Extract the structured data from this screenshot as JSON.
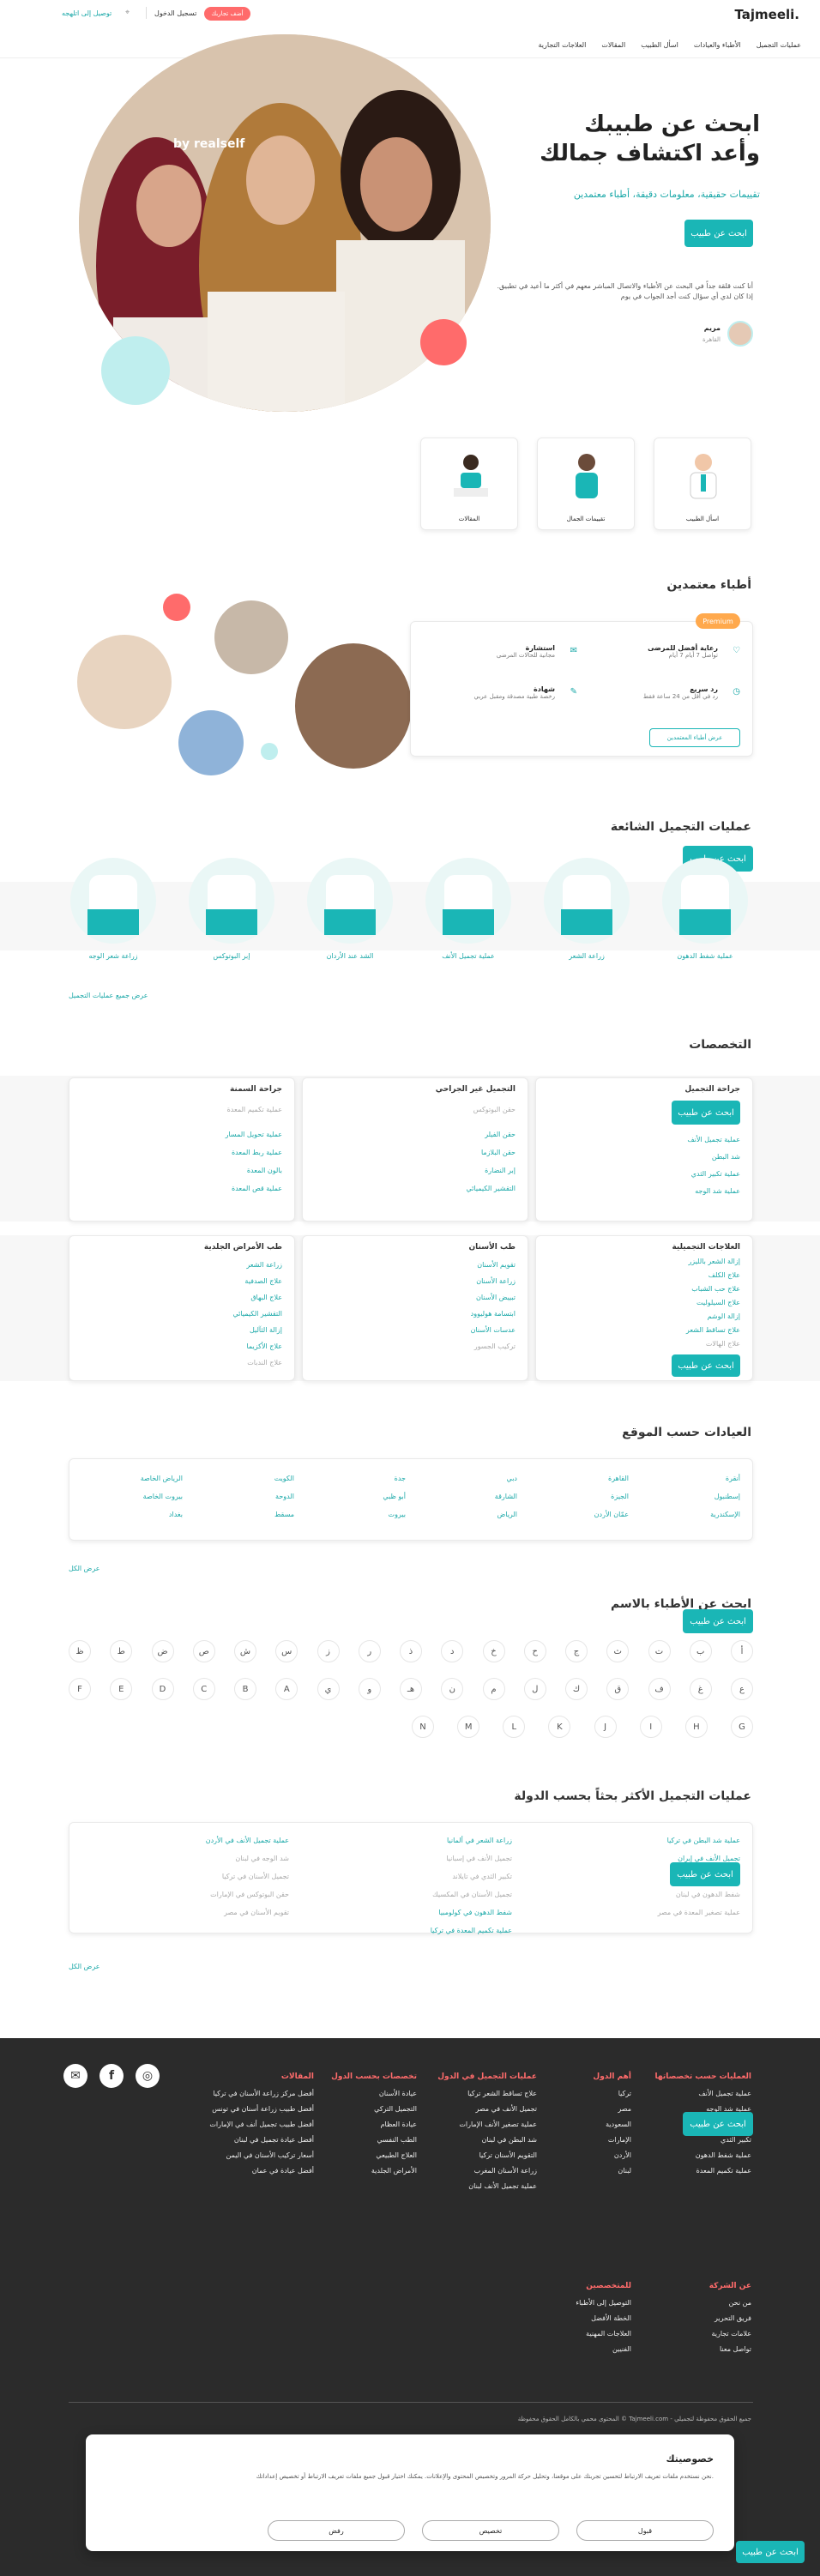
{
  "header": {
    "logo": "Tajmeeli.",
    "nav": [
      "عمليات التجميل",
      "الأطباء والعيادات",
      "اسأل الطبيب",
      "المقالات",
      "العلاجات التجارية"
    ],
    "user_location": "توصيل إلى اتلهجه",
    "login_label": "تسجيل الدخول",
    "cta_label": "أضف تجاربك"
  },
  "hero": {
    "title_line1": "ابحث عن طبيبك",
    "title_line2": "وأعد اكتشاف جمالك",
    "subtitle": "تقييمات حقيقية، معلومات دقيقة، أطباء معتمدين",
    "cta": "ابحث عن طبيب",
    "quote": "أنا كنت قلقة جداً في البحث عن الأطباء والاتصال المباشر معهم في أكثر ما أعيد في تطبيق. إذا كان لدي أي سؤال كنت أجد الجواب في يوم",
    "author_name": "مريم",
    "author_sub": "القاهرة",
    "brand": "by realself"
  },
  "quick_cards": [
    {
      "label": "اسأل الطبيب"
    },
    {
      "label": "تقييمات الجمال"
    },
    {
      "label": "المقالات"
    }
  ],
  "doctors": {
    "title": "أطباء معتمدين",
    "badge": "Premium",
    "features": [
      {
        "title": "رعاية أفضل للمرضى",
        "sub": "تواصل 7 أيام 7 أيام"
      },
      {
        "title": "استشارة",
        "sub": "مجانية للحالات المرضى"
      },
      {
        "title": "رد سريع",
        "sub": "رد في أقل من 24 ساعة فقط"
      },
      {
        "title": "شهادة",
        "sub": "رخصة طبية مصدقة ومقبل عربي"
      }
    ],
    "cta": "عرض أطباء المعتمدين"
  },
  "popular": {
    "title": "عمليات التجميل الشائعة",
    "cta": "ابحث عن طبيب",
    "items": [
      "عملية شفط الدهون",
      "زراعة الشعر",
      "عملية تجميل الأنف",
      "الشد عند الأردان",
      "إبر البوتوكس",
      "زراعة شعر الوجه"
    ],
    "see_all": "عرض جميع عمليات التجميل"
  },
  "specialties": {
    "title": "التخصصات",
    "cta": "ابحث عن طبيب",
    "col1_head": "جراحة التجميل",
    "col1": [
      "عملية تجميل الأنف",
      "شد البطن",
      "عملية تكبير الثدي",
      "عملية شد الوجه",
      "عملية شد الرقبة"
    ],
    "col2_head": "التجميل غير الجراحي",
    "col2": [
      "حقن البوتوكس",
      "حقن الفيلر",
      "حقن البلازما",
      "إبر النضارة",
      "التقشير الكيميائي"
    ],
    "col3_head": "جراحة السمنة",
    "col3": [
      "عملية تكميم المعدة",
      "عملية تحويل المسار",
      "عملية ربط المعدة",
      "بالون المعدة",
      "عملية قص المعدة"
    ],
    "row2_col1_head": "العلاجات التجميلية",
    "row2_col1": [
      "إزالة الشعر بالليزر",
      "علاج الكلف",
      "علاج حب الشباب",
      "علاج السيلوليت",
      "إزالة الوشم",
      "علاج تساقط الشعر",
      "علاج الهالات"
    ],
    "row2_col2_head": "طب الأسنان",
    "row2_col2": [
      "تقويم الأسنان",
      "زراعة الأسنان",
      "تبييض الأسنان",
      "ابتسامة هوليوود",
      "عدسات الأسنان",
      "تركيب الجسور"
    ],
    "row2_col3_head": "طب الأمراض الجلدية",
    "row2_col3": [
      "زراعة الشعر",
      "علاج الصدفية",
      "علاج البهاق",
      "التقشير الكيميائي",
      "إزالة الثآليل",
      "علاج الأكزيما",
      "علاج الندبات"
    ],
    "cta2": "ابحث عن طبيب"
  },
  "clinics": {
    "title": "العيادات حسب الموقع",
    "cols": [
      [
        "أنقرة",
        "إسطنبول",
        "الإسكندرية"
      ],
      [
        "القاهرة",
        "الجيزة",
        "عمّان الأردن"
      ],
      [
        "دبي",
        "الشارقة",
        "الرياض"
      ],
      [
        "جدة",
        "أبو ظبي",
        "بيروت"
      ],
      [
        "الكويت",
        "الدوحة",
        "مسقط"
      ],
      [
        "الرياض الخاصة",
        "بيروت الخاصة",
        "بغداد"
      ]
    ],
    "more": "عرض الكل"
  },
  "alphabet": {
    "title": "ابحث عن الأطباء بالاسم",
    "cta": "ابحث عن طبيب",
    "row1": [
      "أ",
      "ب",
      "ت",
      "ث",
      "ج",
      "ح",
      "خ",
      "د",
      "ذ",
      "ر",
      "ز",
      "س",
      "ش",
      "ص",
      "ض",
      "ط",
      "ظ"
    ],
    "row2": [
      "ع",
      "غ",
      "ف",
      "ق",
      "ك",
      "ل",
      "م",
      "ن",
      "هـ",
      "و",
      "ي",
      "A",
      "B",
      "C",
      "D",
      "E",
      "F"
    ],
    "row3": [
      "G",
      "H",
      "I",
      "J",
      "K",
      "L",
      "M",
      "N"
    ]
  },
  "popular_by_country": {
    "title": "عمليات التجميل الأكثر بحثاً بحسب الدولة",
    "cta": "ابحث عن طبيب",
    "col1": [
      "عملية شد البطن في تركيا",
      "تجميل الأنف في إيران",
      "زراعة الشعر في تركيا",
      "شفط الدهون في لبنان",
      "عملية تصغير المعدة في مصر",
      "الأكزيما المتوسطة في ألمانيا"
    ],
    "col2": [
      "زراعة الشعر في ألمانيا",
      "تجميل الأنف في إسبانيا",
      "تكبير الثدي في تايلاند",
      "تجميل الأسنان في المكسيك",
      "شفط الدهون في كولومبيا",
      "عملية تكميم المعدة في تركيا"
    ],
    "col3": [
      "عملية تجميل الأنف في الأردن",
      "شد الوجه في لبنان",
      "تجميل الأسنان في تركيا",
      "حقن البوتوكس في الإمارات",
      "تقويم الأسنان في مصر",
      "شفط الدهون في السعودية"
    ],
    "more": "عرض الكل"
  },
  "footer": {
    "cols": [
      {
        "head": "العمليات حسب تخصصاتها",
        "items": [
          "عملية تجميل الأنف",
          "عملية شد الوجه",
          "عملية زراعة الشعر",
          "تكبير الثدي",
          "عملية شفط الدهون",
          "عملية تكميم المعدة"
        ]
      },
      {
        "head": "أهم الدول",
        "items": [
          "تركيا",
          "مصر",
          "السعودية",
          "الإمارات",
          "الأردن",
          "لبنان"
        ]
      },
      {
        "head": "عمليات التجميل في الدول",
        "items": [
          "علاج تساقط الشعر تركيا",
          "تجميل الأنف في مصر",
          "عملية تصغير الأنف الإمارات",
          "شد البطن في لبنان",
          "التقويم الأسنان تركيا",
          "زراعة الأسنان المغرب",
          "عملية تجميل الأنف لبنان"
        ]
      },
      {
        "head": "تخصصات بحسب الدول",
        "items": [
          "عيادة الأسنان",
          "التجميل التركي",
          "عيادة العظام",
          "الطب النفسي",
          "العلاج الطبيعي",
          "الأمراض الجلدية"
        ]
      },
      {
        "head": "المقالات",
        "items": [
          "أفضل مركز زراعة الأسنان في تركيا",
          "أفضل طبيب زراعة أسنان في تونس",
          "أفضل طبيب تجميل أنف في الإمارات",
          "أفضل عيادة تجميل في لبنان",
          "أسعار تركيب الأسنان في اليمن",
          "أفضل عيادة في عمان"
        ]
      }
    ],
    "company_head": "عن الشركة",
    "company_items": [
      "من نحن",
      "فريق التحرير",
      "علامات تجارية",
      "تواصل معنا"
    ],
    "partner_head": "للمتخصصين",
    "partner_items": [
      "التوصيل إلى الأطباء",
      "الخطة الأفضل",
      "العلاجات المهنية",
      "الفنيين"
    ],
    "cta": "ابحث عن طبيب",
    "copyright": "المحتوى محمي بالكامل الحقوق محفوظة © Tajmeeli.com - جميع الحقوق محفوظة لتجميلي"
  },
  "cookie": {
    "title": "خصوصيتك",
    "text": "نحن نستخدم ملفات تعريف الارتباط لتحسين تجربتك على موقعنا، وتحليل حركة المرور وتخصيص المحتوى والإعلانات. يمكنك اختيار قبول جميع ملفات تعريف الارتباط أو تخصيص إعداداتك.",
    "accept": "قبول",
    "customize": "تخصيص",
    "reject": "رفض"
  },
  "colors": {
    "teal": "#1ab6b6",
    "coral": "#ff6b6b",
    "dark": "#2b2b2b",
    "orange": "#ffa94d"
  }
}
